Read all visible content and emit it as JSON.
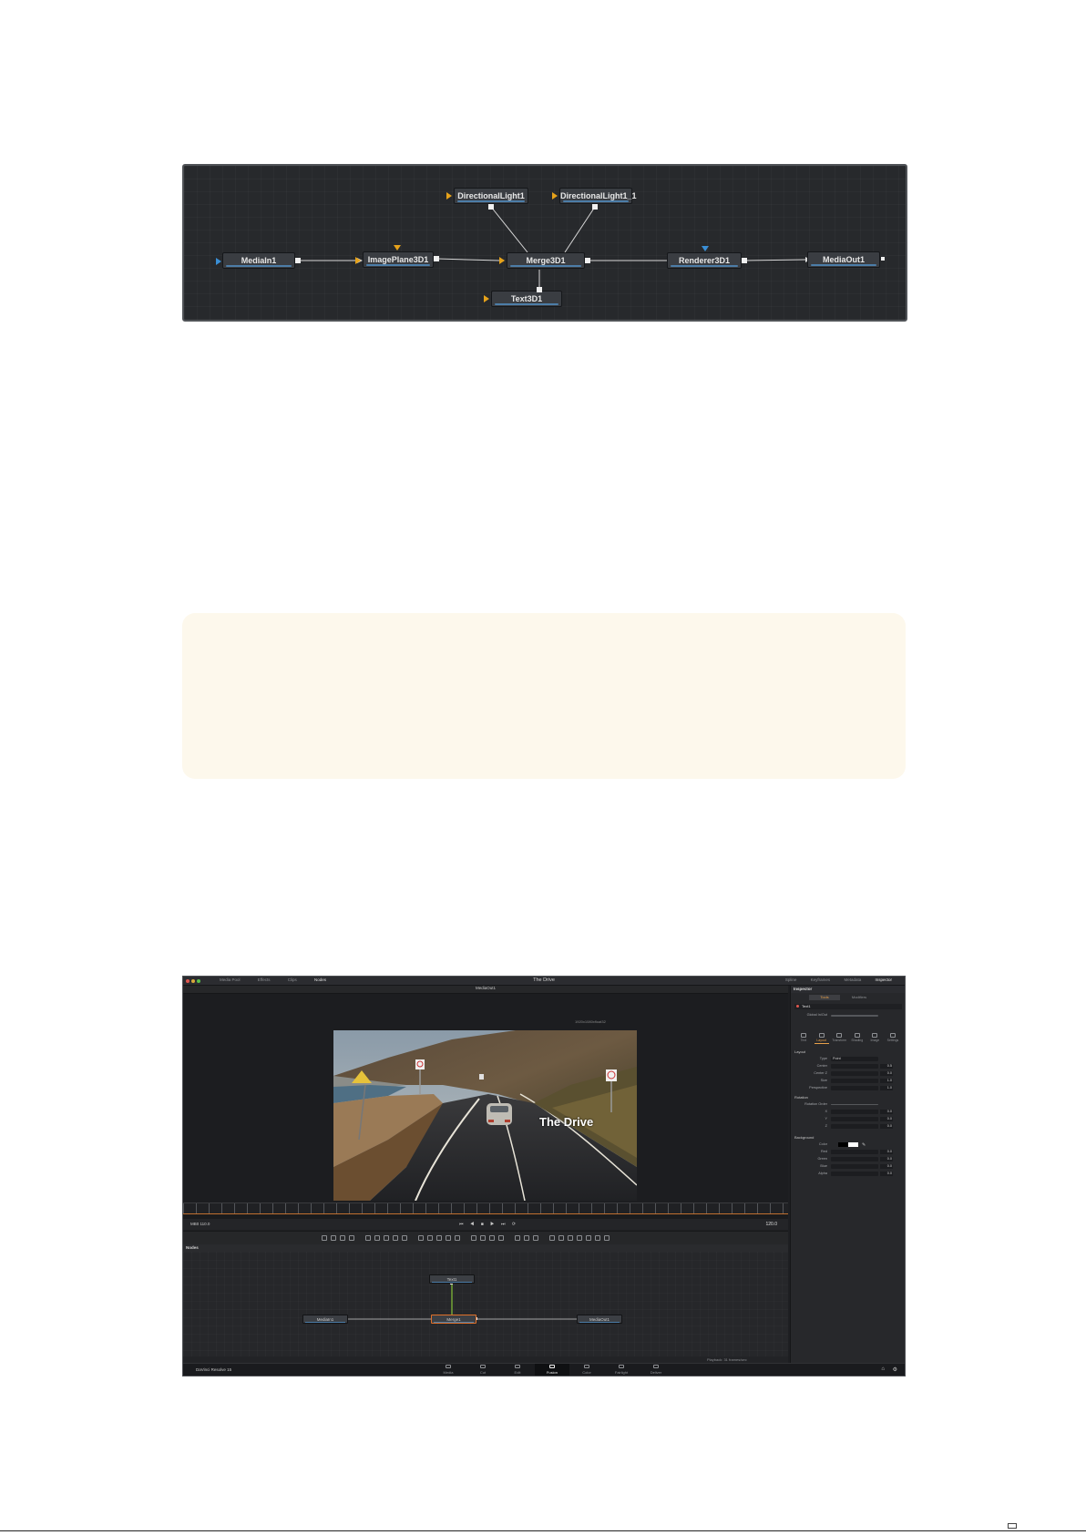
{
  "node_graph": {
    "nodes": [
      {
        "label": "MediaIn1"
      },
      {
        "label": "ImagePlane3D1"
      },
      {
        "label": "DirectionalLight1"
      },
      {
        "label": "DirectionalLight1_1"
      },
      {
        "label": "Merge3D1"
      },
      {
        "label": "Text3D1"
      },
      {
        "label": "Renderer3D1"
      },
      {
        "label": "MediaOut1"
      }
    ]
  },
  "fusion_ui": {
    "window_title": "The Drive",
    "toolbar_left": [
      "Media Pool",
      "Effects",
      "Clips",
      "Nodes"
    ],
    "toolbar_right": [
      "Spline",
      "Keyframes",
      "Metadata",
      "Inspector"
    ],
    "viewer_label": "MediaOut1",
    "viewer_image_label": "1920x1080xfloat32",
    "overlay_text": "The Drive",
    "timecode_left": "MB0  110.0",
    "timecode_right": "120.0",
    "nodes_panel_title": "Nodes",
    "nodes": [
      {
        "label": "MediaIn1"
      },
      {
        "label": "Text1"
      },
      {
        "label": "Merge1"
      },
      {
        "label": "MediaOut1"
      }
    ],
    "status_text": "Playback: 31 frames/sec",
    "brand": "DaVinci Resolve 15",
    "pages": [
      "Media",
      "Cut",
      "Edit",
      "Fusion",
      "Color",
      "Fairlight",
      "Deliver"
    ],
    "active_page": "Fusion",
    "inspector": {
      "title": "Inspector",
      "tabs": [
        "Tools",
        "Modifiers"
      ],
      "tool_name": "Text1",
      "icon_tabs": [
        "Text",
        "Layout",
        "Transform",
        "Shading",
        "Image",
        "Settings"
      ],
      "sections": {
        "layout": "Layout",
        "rotation": "Rotation",
        "background": "Background"
      },
      "rows": [
        {
          "label": "Global In/Out",
          "value": ""
        },
        {
          "label": "Type",
          "value": "Point"
        },
        {
          "label": "Center",
          "value": "0.5"
        },
        {
          "label": "Center Z",
          "value": "0.0"
        },
        {
          "label": "Size",
          "value": "1.0"
        },
        {
          "label": "Perspective",
          "value": "1.0"
        },
        {
          "label": "Rotation Order",
          "value": ""
        },
        {
          "label": "X",
          "value": "0.0"
        },
        {
          "label": "Y",
          "value": "0.0"
        },
        {
          "label": "Z",
          "value": "0.0"
        },
        {
          "label": "Color",
          "value": ""
        },
        {
          "label": "Red",
          "value": "0.0"
        },
        {
          "label": "Green",
          "value": "0.0"
        },
        {
          "label": "Blue",
          "value": "0.0"
        },
        {
          "label": "Alpha",
          "value": "0.0"
        }
      ]
    }
  },
  "colors": {
    "tip_background": "#fdf8ec",
    "node_accent": "#4c7da8",
    "input_arrow": "#e6a21a",
    "mask_arrow": "#3a8fd6",
    "active_node": "#e0702a"
  }
}
